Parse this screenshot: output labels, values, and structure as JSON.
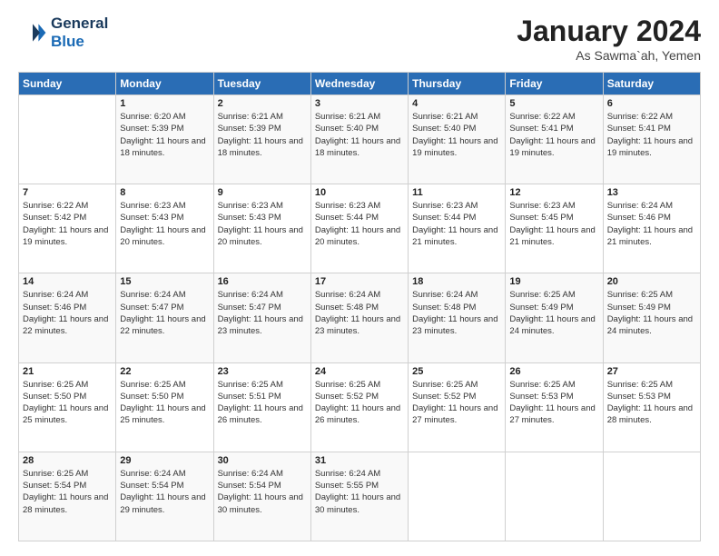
{
  "logo": {
    "line1": "General",
    "line2": "Blue"
  },
  "title": "January 2024",
  "location": "As Sawma`ah, Yemen",
  "header_days": [
    "Sunday",
    "Monday",
    "Tuesday",
    "Wednesday",
    "Thursday",
    "Friday",
    "Saturday"
  ],
  "weeks": [
    [
      {
        "day": "",
        "sunrise": "",
        "sunset": "",
        "daylight": ""
      },
      {
        "day": "1",
        "sunrise": "Sunrise: 6:20 AM",
        "sunset": "Sunset: 5:39 PM",
        "daylight": "Daylight: 11 hours and 18 minutes."
      },
      {
        "day": "2",
        "sunrise": "Sunrise: 6:21 AM",
        "sunset": "Sunset: 5:39 PM",
        "daylight": "Daylight: 11 hours and 18 minutes."
      },
      {
        "day": "3",
        "sunrise": "Sunrise: 6:21 AM",
        "sunset": "Sunset: 5:40 PM",
        "daylight": "Daylight: 11 hours and 18 minutes."
      },
      {
        "day": "4",
        "sunrise": "Sunrise: 6:21 AM",
        "sunset": "Sunset: 5:40 PM",
        "daylight": "Daylight: 11 hours and 19 minutes."
      },
      {
        "day": "5",
        "sunrise": "Sunrise: 6:22 AM",
        "sunset": "Sunset: 5:41 PM",
        "daylight": "Daylight: 11 hours and 19 minutes."
      },
      {
        "day": "6",
        "sunrise": "Sunrise: 6:22 AM",
        "sunset": "Sunset: 5:41 PM",
        "daylight": "Daylight: 11 hours and 19 minutes."
      }
    ],
    [
      {
        "day": "7",
        "sunrise": "Sunrise: 6:22 AM",
        "sunset": "Sunset: 5:42 PM",
        "daylight": "Daylight: 11 hours and 19 minutes."
      },
      {
        "day": "8",
        "sunrise": "Sunrise: 6:23 AM",
        "sunset": "Sunset: 5:43 PM",
        "daylight": "Daylight: 11 hours and 20 minutes."
      },
      {
        "day": "9",
        "sunrise": "Sunrise: 6:23 AM",
        "sunset": "Sunset: 5:43 PM",
        "daylight": "Daylight: 11 hours and 20 minutes."
      },
      {
        "day": "10",
        "sunrise": "Sunrise: 6:23 AM",
        "sunset": "Sunset: 5:44 PM",
        "daylight": "Daylight: 11 hours and 20 minutes."
      },
      {
        "day": "11",
        "sunrise": "Sunrise: 6:23 AM",
        "sunset": "Sunset: 5:44 PM",
        "daylight": "Daylight: 11 hours and 21 minutes."
      },
      {
        "day": "12",
        "sunrise": "Sunrise: 6:23 AM",
        "sunset": "Sunset: 5:45 PM",
        "daylight": "Daylight: 11 hours and 21 minutes."
      },
      {
        "day": "13",
        "sunrise": "Sunrise: 6:24 AM",
        "sunset": "Sunset: 5:46 PM",
        "daylight": "Daylight: 11 hours and 21 minutes."
      }
    ],
    [
      {
        "day": "14",
        "sunrise": "Sunrise: 6:24 AM",
        "sunset": "Sunset: 5:46 PM",
        "daylight": "Daylight: 11 hours and 22 minutes."
      },
      {
        "day": "15",
        "sunrise": "Sunrise: 6:24 AM",
        "sunset": "Sunset: 5:47 PM",
        "daylight": "Daylight: 11 hours and 22 minutes."
      },
      {
        "day": "16",
        "sunrise": "Sunrise: 6:24 AM",
        "sunset": "Sunset: 5:47 PM",
        "daylight": "Daylight: 11 hours and 23 minutes."
      },
      {
        "day": "17",
        "sunrise": "Sunrise: 6:24 AM",
        "sunset": "Sunset: 5:48 PM",
        "daylight": "Daylight: 11 hours and 23 minutes."
      },
      {
        "day": "18",
        "sunrise": "Sunrise: 6:24 AM",
        "sunset": "Sunset: 5:48 PM",
        "daylight": "Daylight: 11 hours and 23 minutes."
      },
      {
        "day": "19",
        "sunrise": "Sunrise: 6:25 AM",
        "sunset": "Sunset: 5:49 PM",
        "daylight": "Daylight: 11 hours and 24 minutes."
      },
      {
        "day": "20",
        "sunrise": "Sunrise: 6:25 AM",
        "sunset": "Sunset: 5:49 PM",
        "daylight": "Daylight: 11 hours and 24 minutes."
      }
    ],
    [
      {
        "day": "21",
        "sunrise": "Sunrise: 6:25 AM",
        "sunset": "Sunset: 5:50 PM",
        "daylight": "Daylight: 11 hours and 25 minutes."
      },
      {
        "day": "22",
        "sunrise": "Sunrise: 6:25 AM",
        "sunset": "Sunset: 5:50 PM",
        "daylight": "Daylight: 11 hours and 25 minutes."
      },
      {
        "day": "23",
        "sunrise": "Sunrise: 6:25 AM",
        "sunset": "Sunset: 5:51 PM",
        "daylight": "Daylight: 11 hours and 26 minutes."
      },
      {
        "day": "24",
        "sunrise": "Sunrise: 6:25 AM",
        "sunset": "Sunset: 5:52 PM",
        "daylight": "Daylight: 11 hours and 26 minutes."
      },
      {
        "day": "25",
        "sunrise": "Sunrise: 6:25 AM",
        "sunset": "Sunset: 5:52 PM",
        "daylight": "Daylight: 11 hours and 27 minutes."
      },
      {
        "day": "26",
        "sunrise": "Sunrise: 6:25 AM",
        "sunset": "Sunset: 5:53 PM",
        "daylight": "Daylight: 11 hours and 27 minutes."
      },
      {
        "day": "27",
        "sunrise": "Sunrise: 6:25 AM",
        "sunset": "Sunset: 5:53 PM",
        "daylight": "Daylight: 11 hours and 28 minutes."
      }
    ],
    [
      {
        "day": "28",
        "sunrise": "Sunrise: 6:25 AM",
        "sunset": "Sunset: 5:54 PM",
        "daylight": "Daylight: 11 hours and 28 minutes."
      },
      {
        "day": "29",
        "sunrise": "Sunrise: 6:24 AM",
        "sunset": "Sunset: 5:54 PM",
        "daylight": "Daylight: 11 hours and 29 minutes."
      },
      {
        "day": "30",
        "sunrise": "Sunrise: 6:24 AM",
        "sunset": "Sunset: 5:54 PM",
        "daylight": "Daylight: 11 hours and 30 minutes."
      },
      {
        "day": "31",
        "sunrise": "Sunrise: 6:24 AM",
        "sunset": "Sunset: 5:55 PM",
        "daylight": "Daylight: 11 hours and 30 minutes."
      },
      {
        "day": "",
        "sunrise": "",
        "sunset": "",
        "daylight": ""
      },
      {
        "day": "",
        "sunrise": "",
        "sunset": "",
        "daylight": ""
      },
      {
        "day": "",
        "sunrise": "",
        "sunset": "",
        "daylight": ""
      }
    ]
  ]
}
